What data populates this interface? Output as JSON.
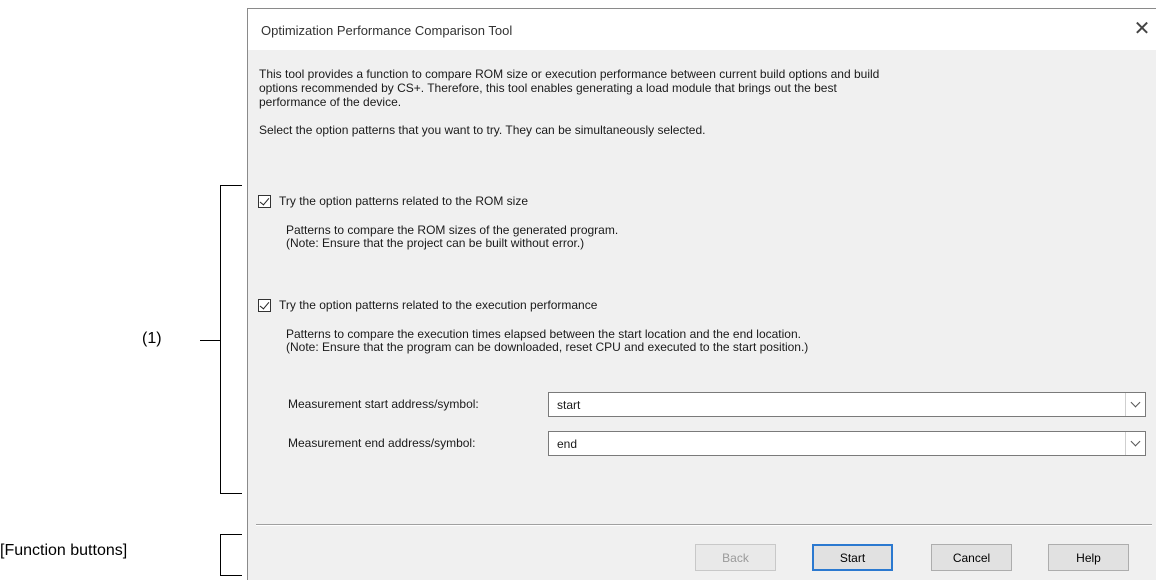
{
  "dialog": {
    "title": "Optimization Performance Comparison Tool",
    "close_glyph": "✕",
    "intro_line1": "This tool provides a function to compare ROM size or execution performance between current build options and build",
    "intro_line2": "options recommended by CS+. Therefore, this tool enables generating a load module that brings out the best",
    "intro_line3": "performance of the device.",
    "select_text": "Select the option patterns that you want to try. They can be simultaneously selected.",
    "rom_option": {
      "label": "Try the option patterns related to the ROM size",
      "checked": true,
      "desc_line1": "Patterns to compare the ROM sizes of the generated program.",
      "desc_line2": "(Note: Ensure that the project can be built without error.)"
    },
    "exec_option": {
      "label": "Try the option patterns related to the execution performance",
      "checked": true,
      "desc_line1": "Patterns to compare the execution times elapsed between the start location and the end location.",
      "desc_line2": "(Note: Ensure that the program can be downloaded, reset CPU and executed to the start position.)"
    },
    "start_field": {
      "label": "Measurement start address/symbol:",
      "value": "start"
    },
    "end_field": {
      "label": "Measurement end address/symbol:",
      "value": "end"
    },
    "buttons": {
      "back": "Back",
      "start": "Start",
      "cancel": "Cancel",
      "help": "Help"
    }
  },
  "annotations": {
    "area1": "(1)",
    "function_buttons": "[Function buttons]"
  },
  "colors": {
    "dialog_bg": "#f0f0f0",
    "titlebar_bg": "#ffffff",
    "default_button_border": "#2b79d0"
  }
}
